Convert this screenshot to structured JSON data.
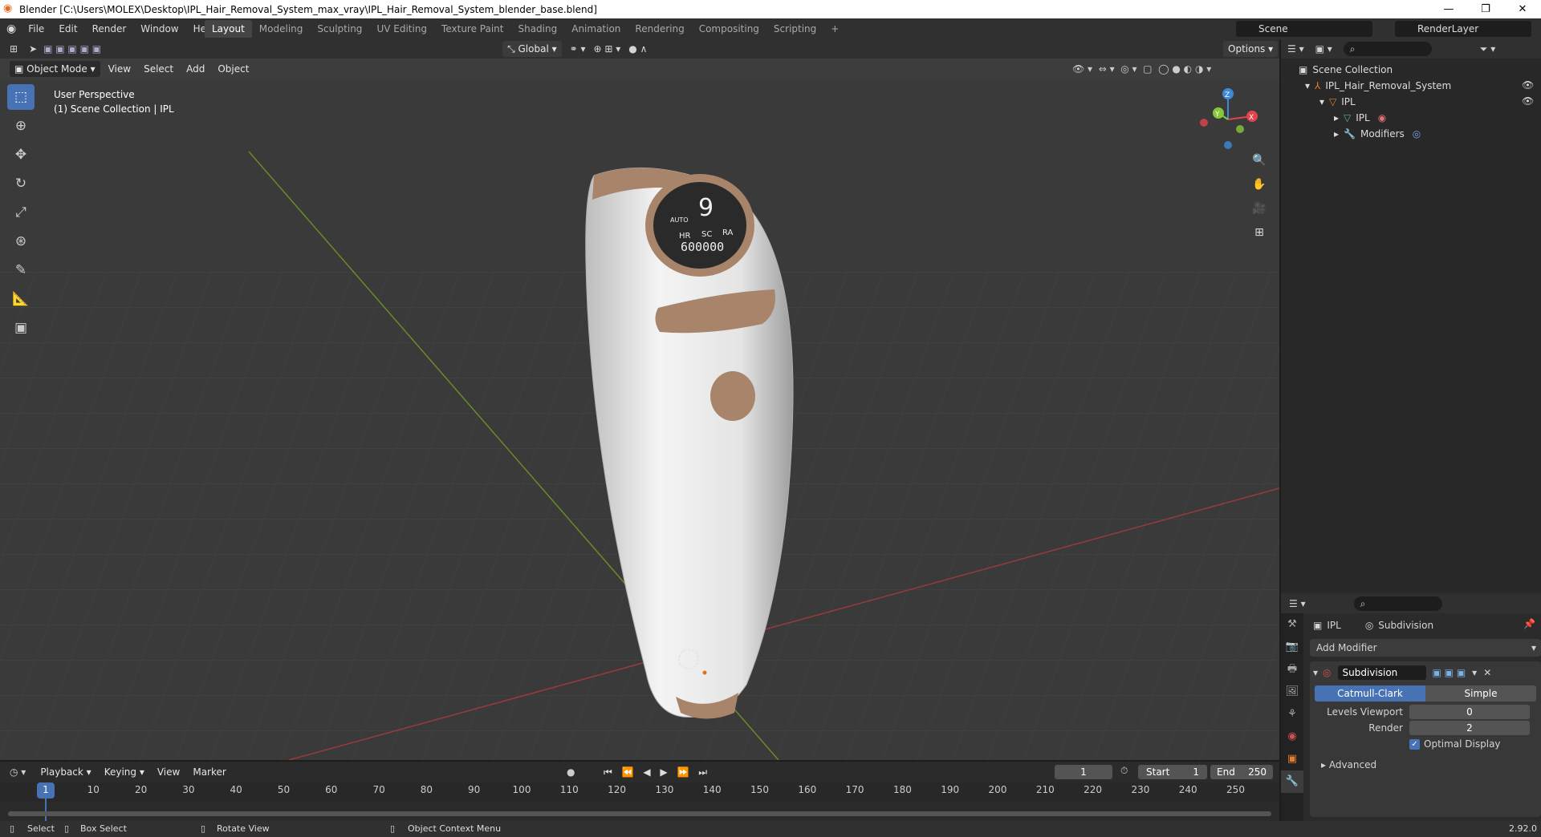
{
  "window": {
    "title": "Blender [C:\\Users\\MOLEX\\Desktop\\IPL_Hair_Removal_System_max_vray\\IPL_Hair_Removal_System_blender_base.blend]",
    "min": "—",
    "max": "❐",
    "close": "✕"
  },
  "menu": [
    "File",
    "Edit",
    "Render",
    "Window",
    "Help"
  ],
  "workspaces": [
    "Layout",
    "Modeling",
    "Sculpting",
    "UV Editing",
    "Texture Paint",
    "Shading",
    "Animation",
    "Rendering",
    "Compositing",
    "Scripting",
    "+"
  ],
  "scene": "Scene",
  "renderlayer": "RenderLayer",
  "viewport": {
    "mode": "Object Mode",
    "menus": [
      "View",
      "Select",
      "Add",
      "Object"
    ],
    "orientation": "Global",
    "options": "Options",
    "perspective": "User Perspective",
    "collection": "(1) Scene Collection | IPL"
  },
  "device": {
    "auto": "AUTO",
    "digit": "9",
    "hr": "HR",
    "sc": "SC",
    "ra": "RA",
    "count": "600000"
  },
  "gizmo": {
    "x": "X",
    "y": "Y",
    "z": "Z"
  },
  "outliner": {
    "root": "Scene Collection",
    "items": [
      "IPL_Hair_Removal_System",
      "IPL",
      "IPL",
      "Modifiers"
    ]
  },
  "properties": {
    "object": "IPL",
    "modifier_crumb": "Subdivision",
    "add_modifier": "Add Modifier",
    "modifier_name": "Subdivision",
    "type_a": "Catmull-Clark",
    "type_b": "Simple",
    "levels_label": "Levels Viewport",
    "levels_value": "0",
    "render_label": "Render",
    "render_value": "2",
    "optimal": "Optimal Display",
    "advanced": "Advanced"
  },
  "timeline": {
    "menus": [
      "Playback",
      "Keying",
      "View",
      "Marker"
    ],
    "current": "1",
    "start_label": "Start",
    "start": "1",
    "end_label": "End",
    "end": "250",
    "ticks": [
      "1",
      "10",
      "20",
      "30",
      "40",
      "50",
      "60",
      "70",
      "80",
      "90",
      "100",
      "110",
      "120",
      "130",
      "140",
      "150",
      "160",
      "170",
      "180",
      "190",
      "200",
      "210",
      "220",
      "230",
      "240",
      "250"
    ]
  },
  "status": {
    "select": "Select",
    "box": "Box Select",
    "rotate": "Rotate View",
    "context": "Object Context Menu",
    "version": "2.92.0"
  },
  "colors": {
    "accent": "#4772b3",
    "body": "#f0f0f0",
    "trim": "#a8846a",
    "x_axis": "#e2444c",
    "y_axis": "#86c73a",
    "z_axis": "#3f88d8"
  }
}
